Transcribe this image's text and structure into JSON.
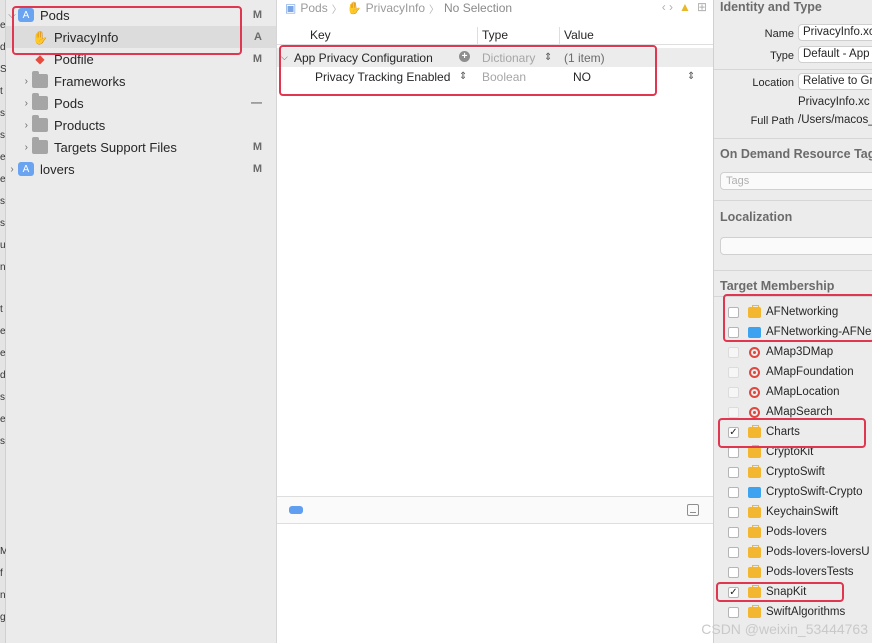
{
  "navigator": {
    "items": [
      {
        "label": "Pods",
        "badge": "M",
        "icon": "project-icon",
        "disclosure": "open"
      },
      {
        "label": "PrivacyInfo",
        "badge": "A",
        "icon": "hand-icon",
        "disclosure": ""
      },
      {
        "label": "Podfile",
        "badge": "M",
        "icon": "ruby-file-icon",
        "disclosure": ""
      },
      {
        "label": "Frameworks",
        "badge": "",
        "icon": "folder-icon",
        "disclosure": "closed"
      },
      {
        "label": "Pods",
        "badge": "—",
        "icon": "folder-icon",
        "disclosure": "closed"
      },
      {
        "label": "Products",
        "badge": "",
        "icon": "folder-icon",
        "disclosure": "closed"
      },
      {
        "label": "Targets Support Files",
        "badge": "M",
        "icon": "folder-icon",
        "disclosure": "closed"
      },
      {
        "label": "lovers",
        "badge": "M",
        "icon": "project-icon",
        "disclosure": "closed"
      }
    ],
    "edge_glyphs": [
      "e",
      "d",
      "S",
      "t",
      "s",
      "s",
      "e",
      "e",
      "s",
      "s",
      "u",
      "n",
      "t",
      "e",
      "e",
      "d",
      "s",
      "e",
      "s",
      "M",
      "f",
      "n",
      "g"
    ]
  },
  "editor": {
    "breadcrumbs": [
      "Pods",
      "PrivacyInfo",
      "No Selection"
    ],
    "nav_arrows": "‹ ›",
    "columns": {
      "key": "Key",
      "type": "Type",
      "value": "Value"
    },
    "rows": [
      {
        "key": "App Privacy Configuration",
        "type": "Dictionary",
        "value": "(1 item)"
      },
      {
        "key": "Privacy Tracking Enabled",
        "type": "Boolean",
        "value": "NO"
      }
    ]
  },
  "inspector": {
    "identity": {
      "title": "Identity and Type",
      "name_label": "Name",
      "name_value": "PrivacyInfo.xc",
      "type_label": "Type",
      "type_value": "Default - App",
      "location_label": "Location",
      "location_value": "Relative to Gr",
      "location_file": "PrivacyInfo.xc",
      "fullpath_label": "Full Path",
      "fullpath_value": "/Users/macos_"
    },
    "odr": {
      "title": "On Demand Resource Tag",
      "placeholder": "Tags"
    },
    "localization": {
      "title": "Localization"
    },
    "membership": {
      "title": "Target Membership",
      "targets": [
        {
          "name": "AFNetworking",
          "checked": false,
          "enabled": true,
          "kind": "static"
        },
        {
          "name": "AFNetworking-AFNe",
          "checked": false,
          "enabled": true,
          "kind": "framework"
        },
        {
          "name": "AMap3DMap",
          "checked": false,
          "enabled": false,
          "kind": "bundle"
        },
        {
          "name": "AMapFoundation",
          "checked": false,
          "enabled": false,
          "kind": "bundle"
        },
        {
          "name": "AMapLocation",
          "checked": false,
          "enabled": false,
          "kind": "bundle"
        },
        {
          "name": "AMapSearch",
          "checked": false,
          "enabled": false,
          "kind": "bundle"
        },
        {
          "name": "Charts",
          "checked": true,
          "enabled": true,
          "kind": "static"
        },
        {
          "name": "CryptoKit",
          "checked": false,
          "enabled": true,
          "kind": "static"
        },
        {
          "name": "CryptoSwift",
          "checked": false,
          "enabled": true,
          "kind": "static"
        },
        {
          "name": "CryptoSwift-Crypto",
          "checked": false,
          "enabled": true,
          "kind": "framework"
        },
        {
          "name": "KeychainSwift",
          "checked": false,
          "enabled": true,
          "kind": "static"
        },
        {
          "name": "Pods-lovers",
          "checked": false,
          "enabled": true,
          "kind": "static"
        },
        {
          "name": "Pods-lovers-loversU",
          "checked": false,
          "enabled": true,
          "kind": "static"
        },
        {
          "name": "Pods-loversTests",
          "checked": false,
          "enabled": true,
          "kind": "static"
        },
        {
          "name": "SnapKit",
          "checked": true,
          "enabled": true,
          "kind": "static"
        },
        {
          "name": "SwiftAlgorithms",
          "checked": false,
          "enabled": true,
          "kind": "static"
        }
      ]
    }
  },
  "watermark": "CSDN @weixin_53444763",
  "colors": {
    "annotation": "#e0364f",
    "accent": "#5f9ef0"
  }
}
